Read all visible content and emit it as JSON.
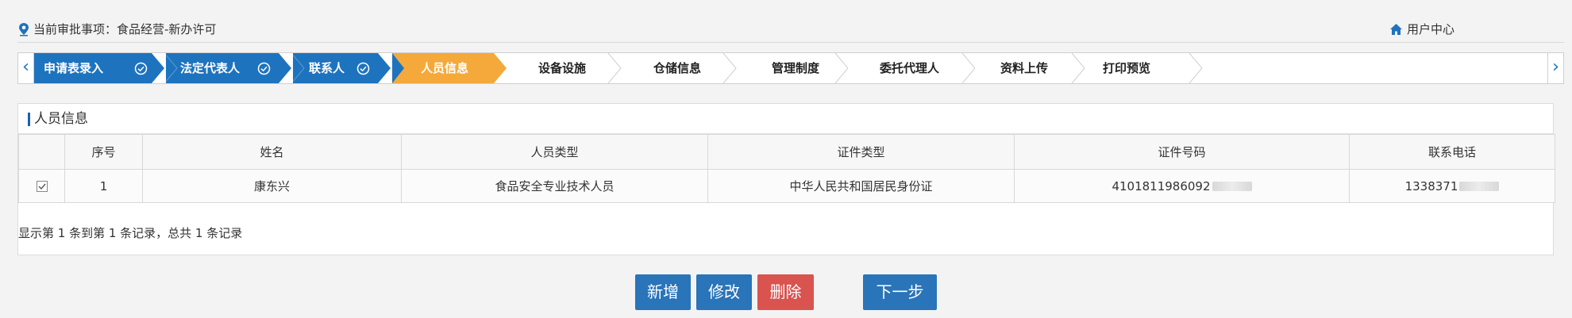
{
  "header": {
    "approval_item": "当前审批事项：食品经营-新办许可",
    "user_center": "用户中心"
  },
  "steps": [
    {
      "label": "申请表录入",
      "state": "done"
    },
    {
      "label": "法定代表人",
      "state": "done"
    },
    {
      "label": "联系人",
      "state": "done"
    },
    {
      "label": "人员信息",
      "state": "active"
    },
    {
      "label": "设备设施",
      "state": "todo"
    },
    {
      "label": "仓储信息",
      "state": "todo"
    },
    {
      "label": "管理制度",
      "state": "todo"
    },
    {
      "label": "委托代理人",
      "state": "todo"
    },
    {
      "label": "资料上传",
      "state": "todo"
    },
    {
      "label": "打印预览",
      "state": "todo"
    }
  ],
  "panel": {
    "title": "人员信息",
    "columns": [
      "序号",
      "姓名",
      "人员类型",
      "证件类型",
      "证件号码",
      "联系电话"
    ],
    "rows": [
      {
        "index": "1",
        "name": "康东兴",
        "type": "食品安全专业技术人员",
        "id_type": "中华人民共和国居民身份证",
        "id_no": "4101811986092",
        "phone": "1338371"
      }
    ],
    "pager": "显示第 1 条到第 1 条记录，总共 1 条记录"
  },
  "buttons": {
    "add": "新增",
    "edit": "修改",
    "delete": "删除",
    "next": "下一步"
  },
  "colors": {
    "done": "#1e73be",
    "active": "#f5a93a",
    "danger": "#d9534f"
  }
}
